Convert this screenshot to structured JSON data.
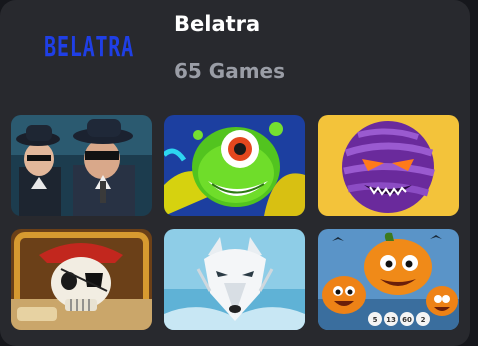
{
  "provider": {
    "logo_text": "BELATRA",
    "name": "Belatra",
    "games_count": "65 Games"
  },
  "games": [
    {
      "art": "mafia-men-art"
    },
    {
      "art": "green-alien-art"
    },
    {
      "art": "purple-mummy-art"
    },
    {
      "art": "pirate-skull-art"
    },
    {
      "art": "white-wolf-art"
    },
    {
      "art": "halloween-pumpkins-art"
    }
  ],
  "bingo_balls": [
    "5",
    "13",
    "60",
    "2"
  ],
  "colors": {
    "card_bg": "#28292e",
    "logo_blue": "#1f3fe6",
    "muted_text": "#9a9da6"
  }
}
